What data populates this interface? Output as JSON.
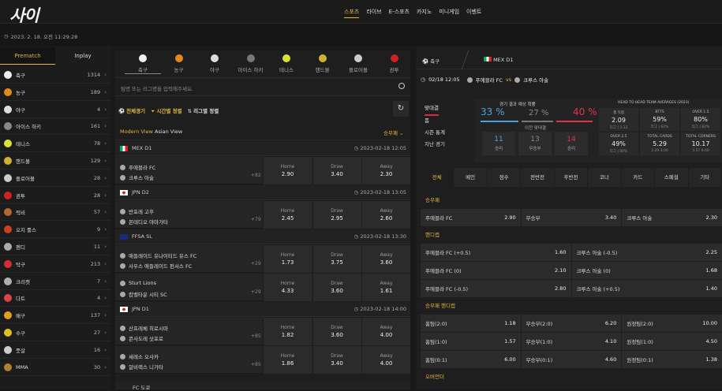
{
  "header": {
    "logo": "사이",
    "nav": [
      "스포츠",
      "라이브",
      "E-스포츠",
      "카지노",
      "미니게임",
      "이벤트"
    ],
    "datetime": "2023. 2. 18. 오전 11:29:28"
  },
  "left": {
    "tabs": [
      "Prematch",
      "Inplay"
    ],
    "sports": [
      {
        "name": "축구",
        "count": "1314",
        "color": "#eeeeee"
      },
      {
        "name": "농구",
        "count": "189",
        "color": "#e08a1e"
      },
      {
        "name": "야구",
        "count": "4",
        "color": "#dddddd"
      },
      {
        "name": "아이스 하키",
        "count": "161",
        "color": "#888888"
      },
      {
        "name": "테니스",
        "count": "78",
        "color": "#d7e23a"
      },
      {
        "name": "핸드볼",
        "count": "129",
        "color": "#d0b030"
      },
      {
        "name": "플로어볼",
        "count": "28",
        "color": "#cccccc"
      },
      {
        "name": "권투",
        "count": "28",
        "color": "#d02020"
      },
      {
        "name": "럭비",
        "count": "57",
        "color": "#b06a30"
      },
      {
        "name": "오지 룰스",
        "count": "9",
        "color": "#d04020"
      },
      {
        "name": "펜디",
        "count": "11",
        "color": "#aaaaaa"
      },
      {
        "name": "탁구",
        "count": "213",
        "color": "#d03030"
      },
      {
        "name": "크리켓",
        "count": "7",
        "color": "#b0b0b0"
      },
      {
        "name": "다트",
        "count": "4",
        "color": "#dd4444"
      },
      {
        "name": "배구",
        "count": "137",
        "color": "#e0a020"
      },
      {
        "name": "수구",
        "count": "27",
        "color": "#e0c020"
      },
      {
        "name": "풋살",
        "count": "16",
        "color": "#cccccc"
      },
      {
        "name": "MMA",
        "count": "30",
        "color": "#b08030"
      }
    ]
  },
  "mid": {
    "sport_tabs": [
      {
        "name": "축구",
        "color": "#eeeeee"
      },
      {
        "name": "농구",
        "color": "#e08a1e"
      },
      {
        "name": "야구",
        "color": "#dddddd"
      },
      {
        "name": "아이스 하키",
        "color": "#777777"
      },
      {
        "name": "테니스",
        "color": "#d7e23a"
      },
      {
        "name": "핸드볼",
        "color": "#d0b030"
      },
      {
        "name": "플로어볼",
        "color": "#cccccc"
      },
      {
        "name": "권투",
        "color": "#d02020"
      }
    ],
    "search_placeholder": "팀명 또는 리그명을 입력해주세요.",
    "filters": [
      "전체경기",
      "시간별 정렬",
      "리그별 정렬"
    ],
    "views": [
      "Modern View",
      "Asian View"
    ],
    "market": "승무패",
    "leagues": [
      {
        "name": "MEX D1",
        "date": "2023-02-18 12:05",
        "flag": "mx",
        "matches": [
          {
            "home": "푸에블라 FC",
            "away": "크루스 아술",
            "more": "+82",
            "odds": [
              "2.90",
              "3.40",
              "2.30"
            ]
          }
        ]
      },
      {
        "name": "JPN D2",
        "date": "2023-02-18 13:05",
        "flag": "jp",
        "matches": [
          {
            "home": "반포레 고후",
            "away": "몬테디오 야마가타",
            "more": "+79",
            "odds": [
              "2.45",
              "2.95",
              "2.60"
            ]
          }
        ]
      },
      {
        "name": "FFSA SL",
        "date": "2023-02-18 13:30",
        "flag": "au",
        "matches": [
          {
            "home": "애들레이드 유나이티드 유스 FC",
            "away": "사우스 애들레이드 펀서스 FC",
            "more": "+29",
            "odds": [
              "1.73",
              "3.75",
              "3.60"
            ]
          },
          {
            "home": "Sturt Lions",
            "away": "캄벨타운 시티 SC",
            "more": "+29",
            "odds": [
              "4.33",
              "3.60",
              "1.61"
            ]
          }
        ]
      },
      {
        "name": "JPN D1",
        "date": "2023-02-18 14:00",
        "flag": "jp",
        "matches": [
          {
            "home": "산프레체 히로시마",
            "away": "콘사도레 삿포로",
            "more": "+85",
            "odds": [
              "1.82",
              "3.60",
              "4.00"
            ]
          },
          {
            "home": "세레소 오사카",
            "away": "알비렉스 니가타",
            "more": "+85",
            "odds": [
              "1.86",
              "3.40",
              "4.00"
            ]
          }
        ]
      }
    ],
    "odds_labels": [
      "Home",
      "Draw",
      "Away"
    ],
    "footer": "FC 도쿄"
  },
  "right": {
    "tabs": [
      "축구",
      "MEX D1"
    ],
    "match": {
      "time": "02/18 12:05",
      "home": "푸에블라 FC",
      "vs": "vs",
      "away": "크루스 아술"
    },
    "stats_menu": [
      "맞대결",
      "폼",
      "시즌 통계",
      "지난 경기"
    ],
    "prob_title": "경기 결과 예상 확률",
    "home_pct": "33 %",
    "draw_pct": "27 %",
    "away_pct": "40 %",
    "pct_sub": [
      "AVG",
      "AVG",
      "CAG"
    ],
    "h2h_label": "이전 맞대결",
    "h2h": [
      {
        "n": "11",
        "l": "승리"
      },
      {
        "n": "13",
        "l": "무승부"
      },
      {
        "n": "14",
        "l": "승리"
      }
    ],
    "avg_title": "HEAD TO HEAD TEAM AVERAGES (2023)",
    "avgs": [
      {
        "k": "총 득점",
        "v": "2.09",
        "s": "리그 | 3.33"
      },
      {
        "k": "BTTS",
        "v": "59%",
        "s": "리그 | 62%"
      },
      {
        "k": "OVER 1.5",
        "v": "80%",
        "s": "리그 | 82%"
      },
      {
        "k": "OVER 2.5",
        "v": "49%",
        "s": "리그 | 60%"
      },
      {
        "k": "TOTAL CARDS",
        "v": "5.29",
        "s": "2.29   3.00"
      },
      {
        "k": "TOTAL CORNERS",
        "v": "10.17",
        "s": "3.57   6.60"
      }
    ],
    "market_tabs": [
      "전체",
      "메인",
      "점수",
      "전반전",
      "후반전",
      "코너",
      "카드",
      "스페셜",
      "기타"
    ],
    "sections": [
      {
        "title": "승무패",
        "rows": [
          [
            [
              "푸에블라 FC",
              "2.90"
            ],
            [
              "무승부",
              "3.40"
            ],
            [
              "크루스 아술",
              "2.30"
            ]
          ]
        ]
      },
      {
        "title": "핸디캡",
        "rows": [
          [
            [
              "푸에블라 FC (+0.5)",
              "1.60"
            ],
            [
              "크루스 아술 (-0.5)",
              "2.25"
            ]
          ],
          [
            [
              "푸에블라 FC (0)",
              "2.10"
            ],
            [
              "크루스 아술 (0)",
              "1.68"
            ]
          ],
          [
            [
              "푸에블라 FC (-0.5)",
              "2.80"
            ],
            [
              "크루스 아술 (+0.5)",
              "1.40"
            ]
          ]
        ]
      },
      {
        "title": "승무패 핸디캡",
        "rows": [
          [
            [
              "홈팀(2:0)",
              "1.18"
            ],
            [
              "무승부(2:0)",
              "6.20"
            ],
            [
              "원정팀(2:0)",
              "10.00"
            ]
          ],
          [
            [
              "홈팀(1:0)",
              "1.57"
            ],
            [
              "무승부(1:0)",
              "4.10"
            ],
            [
              "원정팀(1:0)",
              "4.50"
            ]
          ],
          [
            [
              "홈팀(0:1)",
              "6.00"
            ],
            [
              "무승부(0:1)",
              "4.60"
            ],
            [
              "원정팀(0:1)",
              "1.38"
            ]
          ]
        ]
      },
      {
        "title": "오버언더",
        "rows": []
      }
    ]
  }
}
